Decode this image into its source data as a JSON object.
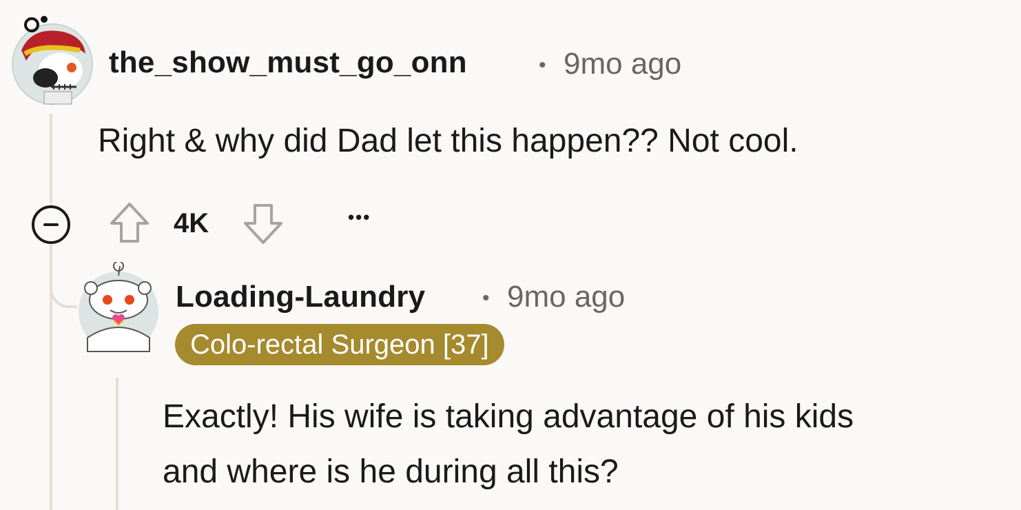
{
  "comment": {
    "author": "the_show_must_go_onn",
    "separator": "•",
    "timestamp": "9mo ago",
    "body": "Right & why did Dad let this happen?? Not cool.",
    "score": "4K",
    "more_label": "•••",
    "avatar_icon": "custom-snoo-avatar-icon"
  },
  "reply": {
    "author": "Loading-Laundry",
    "separator": "•",
    "timestamp": "9mo ago",
    "flair": "Colo-rectal Surgeon [37]",
    "flair_color": "#a58a2e",
    "body_lines": [
      "Exactly! His wife is taking advantage of his kids",
      "and where is he during all this?"
    ],
    "avatar_icon": "snoo-avatar-icon"
  },
  "colors": {
    "background": "#faf9f7",
    "thread_line": "#e5ded6",
    "text": "#1a1a1b",
    "muted": "#6b6660"
  }
}
